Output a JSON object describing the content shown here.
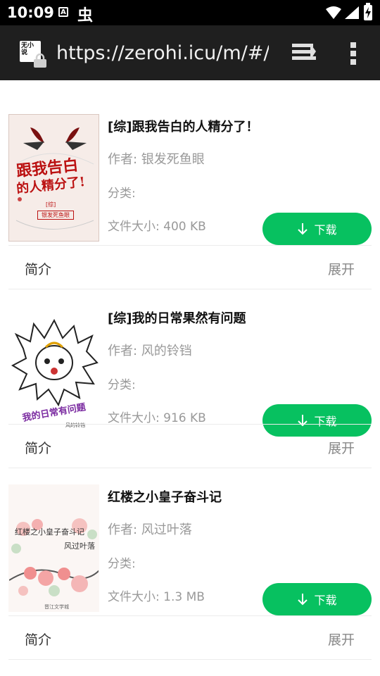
{
  "status_bar": {
    "time": "10:09",
    "a_icon_letter": "A",
    "bug_glyph": "虫",
    "colors": {
      "background": "#000000",
      "foreground": "#ffffff"
    }
  },
  "browser": {
    "url": "https://zerohi.icu/m/#/eb",
    "site_icon_glyph": "无小说",
    "icons": [
      "site-favicon-icon",
      "lock-icon",
      "tabs-icon",
      "overflow-menu-icon"
    ]
  },
  "books": [
    {
      "title": "[综]跟我告白的人精分了！",
      "author": "作者: 银发死鱼眼",
      "category": "分类:",
      "size": "文件大小: 400 KB",
      "download_label": "下载",
      "intro_label": "简介",
      "expand_label": "展开",
      "cover": {
        "line1": "跟我告白",
        "line2": "的人精分了!",
        "tag": "[综]",
        "author": "银发死鱼眼"
      }
    },
    {
      "title": "[综]我的日常果然有问题",
      "author": "作者: 风的铃铛",
      "category": "分类:",
      "size": "文件大小: 916 KB",
      "download_label": "下载",
      "intro_label": "简介",
      "expand_label": "展开",
      "cover": {
        "line1": "我的日常有问题",
        "author": "风的铃铛"
      }
    },
    {
      "title": "红楼之小皇子奋斗记",
      "author": "作者: 风过叶落",
      "category": "分类:",
      "size": "文件大小: 1.3 MB",
      "download_label": "下载",
      "intro_label": "简介",
      "expand_label": "展开",
      "cover": {
        "line1": "红楼之小皇子奋斗记",
        "author": "风过叶落",
        "publisher": "晋江文学城"
      }
    }
  ],
  "accent_color": "#07c160"
}
